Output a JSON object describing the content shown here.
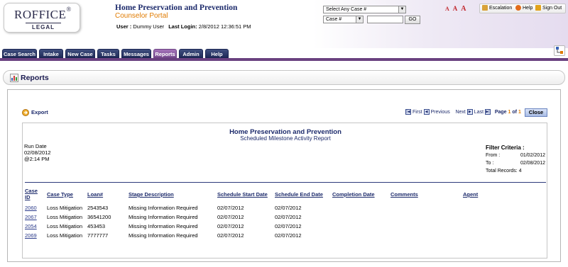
{
  "logo": {
    "main": "ROFFICE",
    "reg": "®",
    "sub": "LEGAL"
  },
  "app": {
    "title": "Home Preservation and Prevention",
    "subtitle": "Counselor Portal",
    "user_label": "User :",
    "user_value": "Dummy User",
    "login_label": "Last Login:",
    "login_value": "2/8/2012 12:36:51 PM"
  },
  "search": {
    "case_select": "Select Any Case #",
    "field_select": "Case #",
    "input_value": "",
    "go_label": "GO"
  },
  "font_sizer": [
    "A",
    "A",
    "A"
  ],
  "top_links": {
    "escalation": "Escalation",
    "help": "Help",
    "signout": "Sign Out"
  },
  "tabs": [
    {
      "label": "Case Search",
      "active": false
    },
    {
      "label": "Intake",
      "active": false
    },
    {
      "label": "New Case",
      "active": false
    },
    {
      "label": "Tasks",
      "active": false
    },
    {
      "label": "Messages",
      "active": false
    },
    {
      "label": "Reports",
      "active": true
    },
    {
      "label": "Admin",
      "active": false
    },
    {
      "label": "Help",
      "active": false
    }
  ],
  "page": {
    "title": "Reports"
  },
  "toolbar": {
    "export_label": "Export",
    "first": "First",
    "previous": "Previous",
    "next": "Next",
    "last": "Last",
    "page_label": "Page",
    "page_current": "1",
    "page_of": "of",
    "page_total": "1",
    "close_label": "Close"
  },
  "report": {
    "title": "Home Preservation and Prevention",
    "subtitle": "Scheduled Milestone Activity Report",
    "run_date_label": "Run Date",
    "run_date": "02/08/2012",
    "run_time": "@2:14 PM",
    "filter": {
      "title": "Filter Criteria :",
      "from_label": "From :",
      "from_value": "01/02/2012",
      "to_label": "To :",
      "to_value": "02/08/2012",
      "total_label": "Total Records:",
      "total_value": "4"
    },
    "columns": {
      "case_id_1": "Case",
      "case_id_2": "ID",
      "case_type": "Case Type",
      "loan": "Loan#",
      "stage": "Stage Description",
      "start": "Schedule Start Date",
      "end": "Schedule End Date",
      "completion": "Completion Date",
      "comments": "Comments",
      "agent": "Agent"
    },
    "rows": [
      {
        "case_id": "2060",
        "case_type": "Loss Mitigation",
        "loan": "2543543",
        "stage": "Missing Information Required",
        "start": "02/07/2012",
        "end": "02/07/2012"
      },
      {
        "case_id": "2067",
        "case_type": "Loss Mitigation",
        "loan": "36541200",
        "stage": "Missing Information Required",
        "start": "02/07/2012",
        "end": "02/07/2012"
      },
      {
        "case_id": "2054",
        "case_type": "Loss Mitigation",
        "loan": "453453",
        "stage": "Missing Information Required",
        "start": "02/07/2012",
        "end": "02/07/2012"
      },
      {
        "case_id": "2069",
        "case_type": "Loss Mitigation",
        "loan": "7777777",
        "stage": "Missing Information Required",
        "start": "02/07/2012",
        "end": "02/07/2012"
      }
    ]
  },
  "colors": {
    "nav_dark": "#1e2a58",
    "nav_active": "#7b4f93",
    "accent_orange": "#e07b00",
    "title_blue": "#1c2a6b"
  }
}
